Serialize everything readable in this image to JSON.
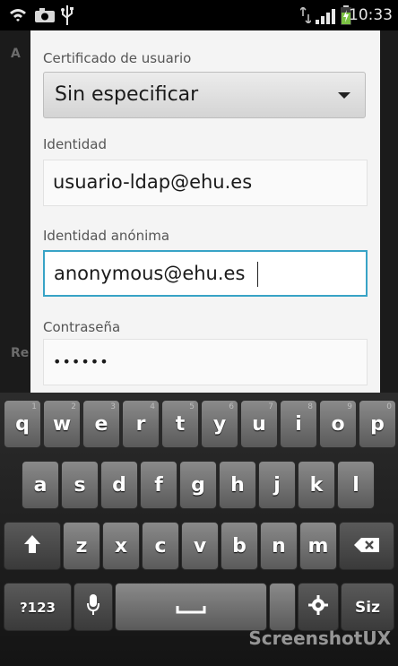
{
  "status_bar": {
    "time": "10:33",
    "icons": [
      "wifi-icon",
      "camera-icon",
      "usb-icon",
      "data-icon",
      "signal-icon",
      "battery-icon"
    ]
  },
  "background": {
    "fragments": [
      "A",
      "Re"
    ]
  },
  "dialog": {
    "cert_label": "Certificado de usuario",
    "cert_value": "Sin especificar",
    "identity_label": "Identidad",
    "identity_value": "usuario-ldap@ehu.es",
    "anon_label": "Identidad anónima",
    "anon_value": "anonymous@ehu.es",
    "password_label": "Contraseña",
    "password_value": "••••••"
  },
  "keyboard": {
    "row1": [
      {
        "key": "q",
        "hint": "1"
      },
      {
        "key": "w",
        "hint": "2"
      },
      {
        "key": "e",
        "hint": "3"
      },
      {
        "key": "r",
        "hint": "4"
      },
      {
        "key": "t",
        "hint": "5"
      },
      {
        "key": "y",
        "hint": "6"
      },
      {
        "key": "u",
        "hint": "7"
      },
      {
        "key": "i",
        "hint": "8"
      },
      {
        "key": "o",
        "hint": "9"
      },
      {
        "key": "p",
        "hint": "0"
      }
    ],
    "row2": [
      "a",
      "s",
      "d",
      "f",
      "g",
      "h",
      "j",
      "k",
      "l"
    ],
    "row3": [
      "z",
      "x",
      "c",
      "v",
      "b",
      "n",
      "m"
    ],
    "symbols_label": "?123",
    "settings_partial": "Siz",
    "watermark": "ScreenshotUX"
  },
  "colors": {
    "focus": "#38a3c6",
    "dialog_bg": "#f4f4f4",
    "key_top": "#8a8a8a",
    "key_bottom": "#5a5a5a"
  }
}
